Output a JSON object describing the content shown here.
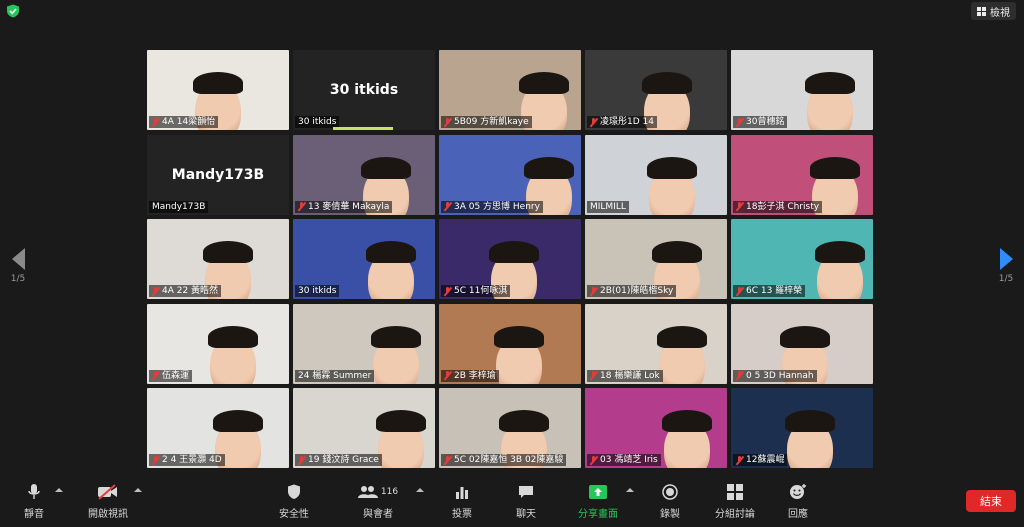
{
  "top": {
    "view_label": "檢視"
  },
  "pager": {
    "left": "1/5",
    "right": "1/5"
  },
  "tiles": [
    {
      "name": "4A 14梁韻怡",
      "bg": "#e9e7df",
      "type": "video",
      "muted": true
    },
    {
      "name": "30 itkids",
      "bg": "#232323",
      "type": "name",
      "display": "30 itkids",
      "muted": false,
      "speaking": true
    },
    {
      "name": "5B09 方新凱kaye",
      "bg": "#b9a58f",
      "type": "video",
      "muted": true
    },
    {
      "name": "凌璟彤1D 14",
      "bg": "#3a3a3a",
      "type": "video",
      "muted": true
    },
    {
      "name": "30曾穗銘",
      "bg": "#d8d8d8",
      "type": "video",
      "muted": true
    },
    {
      "name": "Mandy173B",
      "bg": "#232323",
      "type": "name",
      "display": "Mandy173B",
      "muted": false,
      "active": true
    },
    {
      "name": "13 麥倩華 Makayla",
      "bg": "#6b5f78",
      "type": "video",
      "muted": true
    },
    {
      "name": "3A 05 方思博 Henry",
      "bg": "#4a63b8",
      "type": "video",
      "muted": true
    },
    {
      "name": "MILMILL",
      "bg": "#cfd2d6",
      "type": "video",
      "muted": false
    },
    {
      "name": "18彭子淇 Christy",
      "bg": "#c0507a",
      "type": "video",
      "muted": true
    },
    {
      "name": "4A 22 黃晧然",
      "bg": "#dedbd6",
      "type": "video",
      "muted": true
    },
    {
      "name": "30 itkids",
      "bg": "#3a4fa6",
      "type": "video",
      "muted": false
    },
    {
      "name": "5C 11何咏淇",
      "bg": "#3a2a6a",
      "type": "video",
      "muted": true
    },
    {
      "name": "2B(01)陳皓楷Sky",
      "bg": "#c9c2b6",
      "type": "video",
      "muted": true
    },
    {
      "name": "6C 13 羅梓榮",
      "bg": "#4fb6b4",
      "type": "video",
      "muted": true
    },
    {
      "name": "伍森運",
      "bg": "#e8e6e2",
      "type": "video",
      "muted": true
    },
    {
      "name": "24 楊霖 Summer",
      "bg": "#cfc8bf",
      "type": "video",
      "muted": false
    },
    {
      "name": "2B 李梓瑜",
      "bg": "#b27a52",
      "type": "video",
      "muted": true
    },
    {
      "name": "18 楊樂謙 Lok",
      "bg": "#d9d2c8",
      "type": "video",
      "muted": true
    },
    {
      "name": "0 5 3D Hannah",
      "bg": "#d6cdc8",
      "type": "video",
      "muted": true
    },
    {
      "name": "2 4 王景灝 4D",
      "bg": "#e3e3e1",
      "type": "video",
      "muted": true
    },
    {
      "name": "19 錢汶詩 Grace",
      "bg": "#d9d6d0",
      "type": "video",
      "muted": true
    },
    {
      "name": "5C 02陳嘉恒 3B 02陳嘉駿",
      "bg": "#c8c1b8",
      "type": "video",
      "muted": true
    },
    {
      "name": "03 馮靖芝 Iris",
      "bg": "#b43c8c",
      "type": "video",
      "muted": true
    },
    {
      "name": "12蘇震崐",
      "bg": "#1c2f4f",
      "type": "video",
      "muted": true
    }
  ],
  "toolbar": {
    "mute_label": "靜音",
    "video_label": "開啟視訊",
    "security_label": "安全性",
    "participants_label": "與會者",
    "participants_count": "116",
    "polls_label": "投票",
    "chat_label": "聊天",
    "share_label": "分享畫面",
    "record_label": "錄製",
    "breakout_label": "分組討論",
    "reactions_label": "回應",
    "end_label": "結束",
    "share_color": "#26c65a",
    "end_color": "#e02828"
  }
}
